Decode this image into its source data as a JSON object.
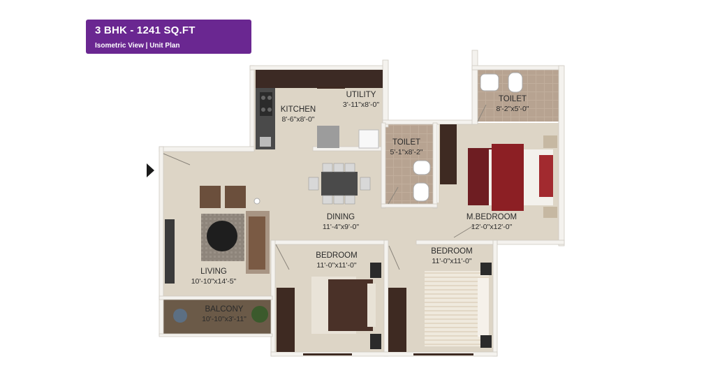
{
  "header": {
    "title": "3 BHK - 1241 SQ.FT",
    "subtitle": "Isometric View | Unit Plan",
    "color": "#6a2791"
  },
  "rooms": {
    "kitchen": {
      "name": "KITCHEN",
      "dims": "8'-6\"x8'-0\""
    },
    "utility": {
      "name": "UTILITY",
      "dims": "3'-11\"x8'-0\""
    },
    "toilet1": {
      "name": "TOILET",
      "dims": "5'-1\"x8'-2\""
    },
    "toilet2": {
      "name": "TOILET",
      "dims": "8'-2\"x5'-0\""
    },
    "dining": {
      "name": "DINING",
      "dims": "11'-4\"x9'-0\""
    },
    "mbedroom": {
      "name": "M.BEDROOM",
      "dims": "12'-0\"x12'-0\""
    },
    "living": {
      "name": "LIVING",
      "dims": "10'-10\"x14'-5\""
    },
    "bedroom1": {
      "name": "BEDROOM",
      "dims": "11'-0\"x11'-0\""
    },
    "bedroom2": {
      "name": "BEDROOM",
      "dims": "11'-0\"x11'-0\""
    },
    "balcony": {
      "name": "BALCONY",
      "dims": "10'-10\"x3'-11\""
    }
  },
  "colors": {
    "floor": "#ddd5c6",
    "wall": "#f4f2ee",
    "tile": "#b5a18f",
    "wood": "#3e2a22",
    "accent_red": "#8c1f24"
  }
}
